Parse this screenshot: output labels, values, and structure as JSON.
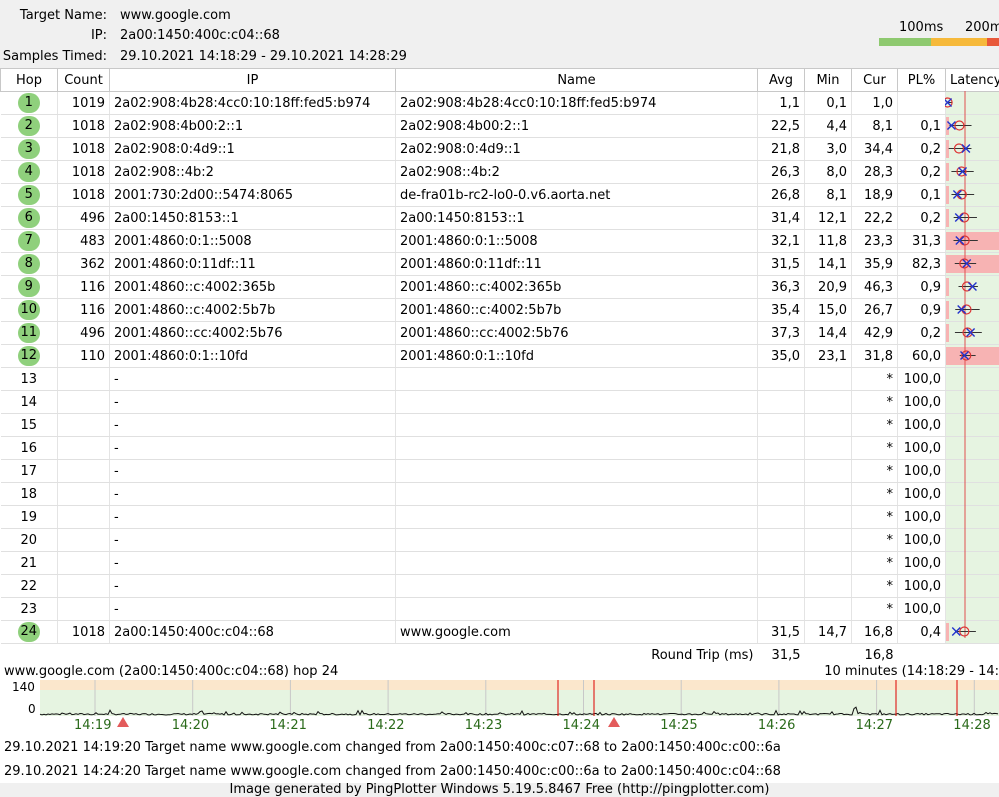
{
  "header": {
    "target_label": "Target Name:",
    "target_value": "www.google.com",
    "ip_label": "IP:",
    "ip_value": "2a00:1450:400c:c04::68",
    "samples_label": "Samples Timed:",
    "samples_value": "29.10.2021 14:18:29 - 29.10.2021 14:28:29",
    "legend_100": "100ms",
    "legend_200": "200m",
    "legend_colors": {
      "good": "#8ec96f",
      "warn": "#f6b93b",
      "bad": "#e8583a"
    }
  },
  "columns": {
    "hop": "Hop",
    "count": "Count",
    "ip": "IP",
    "name": "Name",
    "avg": "Avg",
    "min": "Min",
    "cur": "Cur",
    "pl": "PL%",
    "latency": "Latency"
  },
  "hops": [
    {
      "hop": "1",
      "count": "1019",
      "ip": "2a02:908:4b28:4cc0:10:18ff:fed5:b974",
      "name": "2a02:908:4b28:4cc0:10:18ff:fed5:b974",
      "avg": "1,1",
      "min": "0,1",
      "cur": "1,0",
      "pl": "",
      "pl_value": 0
    },
    {
      "hop": "2",
      "count": "1018",
      "ip": "2a02:908:4b00:2::1",
      "name": "2a02:908:4b00:2::1",
      "avg": "22,5",
      "min": "4,4",
      "cur": "8,1",
      "pl": "0,1",
      "pl_value": 0.1
    },
    {
      "hop": "3",
      "count": "1018",
      "ip": "2a02:908:0:4d9::1",
      "name": "2a02:908:0:4d9::1",
      "avg": "21,8",
      "min": "3,0",
      "cur": "34,4",
      "pl": "0,2",
      "pl_value": 0.2
    },
    {
      "hop": "4",
      "count": "1018",
      "ip": "2a02:908::4b:2",
      "name": "2a02:908::4b:2",
      "avg": "26,3",
      "min": "8,0",
      "cur": "28,3",
      "pl": "0,2",
      "pl_value": 0.2
    },
    {
      "hop": "5",
      "count": "1018",
      "ip": "2001:730:2d00::5474:8065",
      "name": "de-fra01b-rc2-lo0-0.v6.aorta.net",
      "avg": "26,8",
      "min": "8,1",
      "cur": "18,9",
      "pl": "0,1",
      "pl_value": 0.1
    },
    {
      "hop": "6",
      "count": "496",
      "ip": "2a00:1450:8153::1",
      "name": "2a00:1450:8153::1",
      "avg": "31,4",
      "min": "12,1",
      "cur": "22,2",
      "pl": "0,2",
      "pl_value": 0.2
    },
    {
      "hop": "7",
      "count": "483",
      "ip": "2001:4860:0:1::5008",
      "name": "2001:4860:0:1::5008",
      "avg": "32,1",
      "min": "11,8",
      "cur": "23,3",
      "pl": "31,3",
      "pl_value": 31.3
    },
    {
      "hop": "8",
      "count": "362",
      "ip": "2001:4860:0:11df::11",
      "name": "2001:4860:0:11df::11",
      "avg": "31,5",
      "min": "14,1",
      "cur": "35,9",
      "pl": "82,3",
      "pl_value": 82.3
    },
    {
      "hop": "9",
      "count": "116",
      "ip": "2001:4860::c:4002:365b",
      "name": "2001:4860::c:4002:365b",
      "avg": "36,3",
      "min": "20,9",
      "cur": "46,3",
      "pl": "0,9",
      "pl_value": 0.9
    },
    {
      "hop": "10",
      "count": "116",
      "ip": "2001:4860::c:4002:5b7b",
      "name": "2001:4860::c:4002:5b7b",
      "avg": "35,4",
      "min": "15,0",
      "cur": "26,7",
      "pl": "0,9",
      "pl_value": 0.9
    },
    {
      "hop": "11",
      "count": "496",
      "ip": "2001:4860::cc:4002:5b76",
      "name": "2001:4860::cc:4002:5b76",
      "avg": "37,3",
      "min": "14,4",
      "cur": "42,9",
      "pl": "0,2",
      "pl_value": 0.2
    },
    {
      "hop": "12",
      "count": "110",
      "ip": "2001:4860:0:1::10fd",
      "name": "2001:4860:0:1::10fd",
      "avg": "35,0",
      "min": "23,1",
      "cur": "31,8",
      "pl": "60,0",
      "pl_value": 60.0
    },
    {
      "hop": "13",
      "count": "",
      "ip": "-",
      "name": "",
      "avg": "",
      "min": "",
      "cur": "*",
      "pl": "100,0",
      "pl_value": 100
    },
    {
      "hop": "14",
      "count": "",
      "ip": "-",
      "name": "",
      "avg": "",
      "min": "",
      "cur": "*",
      "pl": "100,0",
      "pl_value": 100
    },
    {
      "hop": "15",
      "count": "",
      "ip": "-",
      "name": "",
      "avg": "",
      "min": "",
      "cur": "*",
      "pl": "100,0",
      "pl_value": 100
    },
    {
      "hop": "16",
      "count": "",
      "ip": "-",
      "name": "",
      "avg": "",
      "min": "",
      "cur": "*",
      "pl": "100,0",
      "pl_value": 100
    },
    {
      "hop": "17",
      "count": "",
      "ip": "-",
      "name": "",
      "avg": "",
      "min": "",
      "cur": "*",
      "pl": "100,0",
      "pl_value": 100
    },
    {
      "hop": "18",
      "count": "",
      "ip": "-",
      "name": "",
      "avg": "",
      "min": "",
      "cur": "*",
      "pl": "100,0",
      "pl_value": 100
    },
    {
      "hop": "19",
      "count": "",
      "ip": "-",
      "name": "",
      "avg": "",
      "min": "",
      "cur": "*",
      "pl": "100,0",
      "pl_value": 100
    },
    {
      "hop": "20",
      "count": "",
      "ip": "-",
      "name": "",
      "avg": "",
      "min": "",
      "cur": "*",
      "pl": "100,0",
      "pl_value": 100
    },
    {
      "hop": "21",
      "count": "",
      "ip": "-",
      "name": "",
      "avg": "",
      "min": "",
      "cur": "*",
      "pl": "100,0",
      "pl_value": 100
    },
    {
      "hop": "22",
      "count": "",
      "ip": "-",
      "name": "",
      "avg": "",
      "min": "",
      "cur": "*",
      "pl": "100,0",
      "pl_value": 100
    },
    {
      "hop": "23",
      "count": "",
      "ip": "-",
      "name": "",
      "avg": "",
      "min": "",
      "cur": "*",
      "pl": "100,0",
      "pl_value": 100
    },
    {
      "hop": "24",
      "count": "1018",
      "ip": "2a00:1450:400c:c04::68",
      "name": "www.google.com",
      "avg": "31,5",
      "min": "14,7",
      "cur": "16,8",
      "pl": "0,4",
      "pl_value": 0.4
    }
  ],
  "round_trip": {
    "label": "Round Trip (ms)",
    "avg": "31,5",
    "cur": "16,8"
  },
  "graph": {
    "title": "www.google.com (2a00:1450:400c:c04::68) hop 24",
    "range": "10 minutes (14:18:29 - 14:",
    "y_max": "140",
    "y_min": "0",
    "x_labels": [
      "14:19",
      "14:20",
      "14:21",
      "14:22",
      "14:23",
      "14:24",
      "14:25",
      "14:26",
      "14:27",
      "14:28"
    ],
    "marker_times": [
      "14:19",
      "14:24"
    ]
  },
  "events": [
    "29.10.2021 14:19:20 Target name www.google.com changed from 2a00:1450:400c:c07::68 to 2a00:1450:400c:c00::6a",
    "29.10.2021 14:24:20 Target name www.google.com changed from 2a00:1450:400c:c00::6a to 2a00:1450:400c:c04::68"
  ],
  "footer": "Image generated by PingPlotter Windows 5.19.5.8467 Free (http://pingplotter.com)"
}
